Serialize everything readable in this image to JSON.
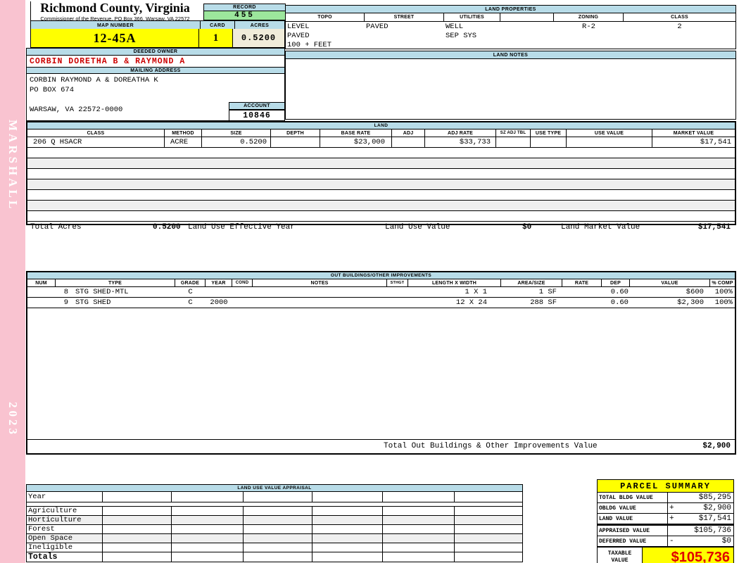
{
  "sidebar": {
    "vendor": "MARSHALL",
    "year": "2023"
  },
  "header": {
    "county": "Richmond County, Virginia",
    "commissioner": "Commissioner of the Revenue, PO Box 366, Warsaw, VA 22572",
    "record_label": "RECORD",
    "record_value": "455",
    "map_label": "MAP NUMBER",
    "map_value": "12-45A",
    "card_label": "CARD",
    "card_value": "1",
    "acres_label": "ACRES",
    "acres_value": "0.5200",
    "deeded_owner_label": "DEEDED OWNER",
    "owner_name": "CORBIN DORETHA B & RAYMOND A",
    "mailing_label": "MAILING ADDRESS",
    "mailing_lines": [
      "CORBIN RAYMOND A & DOREATHA K",
      "PO BOX 674",
      "WARSAW, VA 22572-0000"
    ],
    "account_label": "ACCOUNT",
    "account_value": "10846"
  },
  "land_properties": {
    "title": "LAND PROPERTIES",
    "columns": [
      "TOPO",
      "STREET",
      "UTILITIES",
      "",
      "ZONING",
      "CLASS"
    ],
    "rows": [
      [
        "LEVEL",
        "PAVED",
        "WELL",
        "",
        "R-2",
        "2"
      ],
      [
        "PAVED",
        "",
        "SEP SYS",
        "",
        "",
        ""
      ],
      [
        "100 + FEET",
        "",
        "",
        "",
        "",
        ""
      ]
    ]
  },
  "land_notes": {
    "title": "LAND NOTES"
  },
  "land": {
    "title": "LAND",
    "columns": [
      "CLASS",
      "METHOD",
      "SIZE",
      "DEPTH",
      "BASE RATE",
      "ADJ",
      "ADJ RATE",
      "SZ ADJ TBL",
      "USE TYPE",
      "USE VALUE",
      "MARKET VALUE"
    ],
    "row": [
      "206 Q HSACR",
      "ACRE",
      "0.5200",
      "",
      "$23,000",
      "",
      "$33,733",
      "",
      "",
      "",
      "$17,541"
    ],
    "totals": {
      "total_acres_label": "Total Acres",
      "total_acres": "0.5200",
      "effective_year_label": "Land Use Effective Year",
      "use_value_label": "Land Use Value",
      "use_value": "$0",
      "market_value_label": "Land Market Value",
      "market_value": "$17,541"
    }
  },
  "outbuildings": {
    "title": "OUT BUILDINGS/OTHER IMPROVEMENTS",
    "columns": [
      "NUM",
      "TYPE",
      "GRADE",
      "YEAR",
      "COND",
      "NOTES",
      "STHGT",
      "LENGTH X WIDTH",
      "AREA/SIZE",
      "RATE",
      "DEP",
      "VALUE",
      "% COMP"
    ],
    "rows": [
      {
        "num": "8",
        "type": "STG SHED-MTL",
        "grade": "C",
        "year": "",
        "cond": "",
        "notes": "",
        "sthgt": "",
        "dims": "1 X 1",
        "area": "1 SF",
        "rate": "",
        "dep": "0.60",
        "value": "$600",
        "comp": "100%"
      },
      {
        "num": "9",
        "type": "STG SHED",
        "grade": "C",
        "year": "2000",
        "cond": "",
        "notes": "",
        "sthgt": "",
        "dims": "12 X 24",
        "area": "288 SF",
        "rate": "",
        "dep": "0.60",
        "value": "$2,300",
        "comp": "100%"
      }
    ],
    "total_label": "Total Out Buildings & Other Improvements Value",
    "total_value": "$2,900"
  },
  "land_use_appraisal": {
    "title": "LAND USE VALUE APPRAISAL",
    "row_labels": [
      "Year",
      "Agriculture",
      "Horticulture",
      "Forest",
      "Open Space",
      "Ineligible",
      "Totals"
    ]
  },
  "parcel_summary": {
    "title": "PARCEL SUMMARY",
    "rows": [
      {
        "label": "TOTAL BLDG VALUE",
        "op": "",
        "value": "$85,295"
      },
      {
        "label": "OBLDG VALUE",
        "op": "+",
        "value": "$2,900"
      },
      {
        "label": "LAND VALUE",
        "op": "+",
        "value": "$17,541"
      },
      {
        "label": "APPRAISED VALUE",
        "op": "",
        "value": "$105,736"
      },
      {
        "label": "DEFERRED VALUE",
        "op": "-",
        "value": "$0"
      }
    ],
    "taxable_label": "TAXABLE VALUE",
    "taxable_value": "$105,736"
  }
}
